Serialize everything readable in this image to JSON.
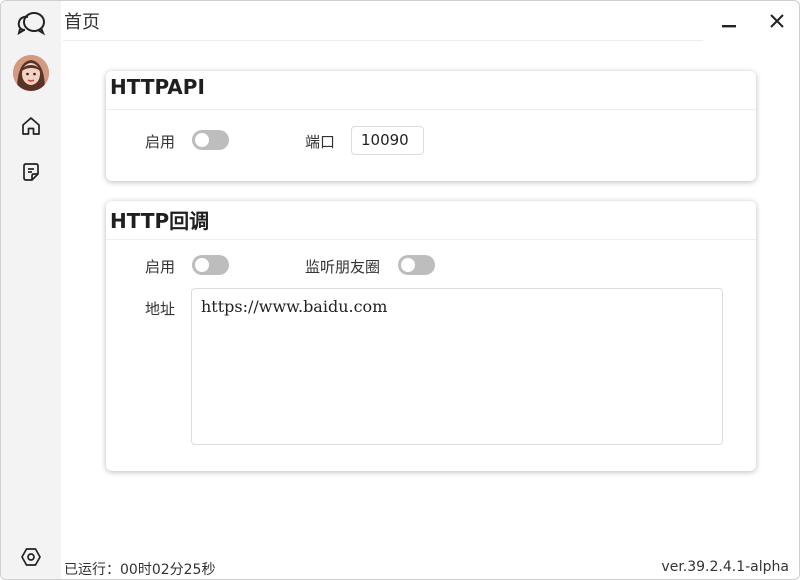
{
  "window": {
    "title": "首页",
    "minimize_icon": "minimize-icon",
    "close_icon": "close-icon"
  },
  "sidebar": {
    "logo_icon": "chat-bubbles-icon",
    "items": [
      {
        "icon": "home-icon"
      },
      {
        "icon": "note-icon"
      },
      {
        "icon": "settings-hexagon-icon"
      }
    ]
  },
  "httpapi": {
    "title": "HTTPAPI",
    "enable_label": "启用",
    "enable_on": false,
    "port_label": "端口",
    "port_value": "10090"
  },
  "callback": {
    "title": "HTTP回调",
    "enable_label": "启用",
    "enable_on": false,
    "listen_moments_label": "监听朋友圈",
    "listen_moments_on": false,
    "address_label": "地址",
    "address_value": "https://www.baidu.com"
  },
  "status": {
    "uptime": "已运行：00时02分25秒",
    "version": "ver.39.2.4.1-alpha"
  },
  "colors": {
    "sidebar_bg": "#f3f3f3",
    "toggle_off": "#bdbdbd"
  }
}
